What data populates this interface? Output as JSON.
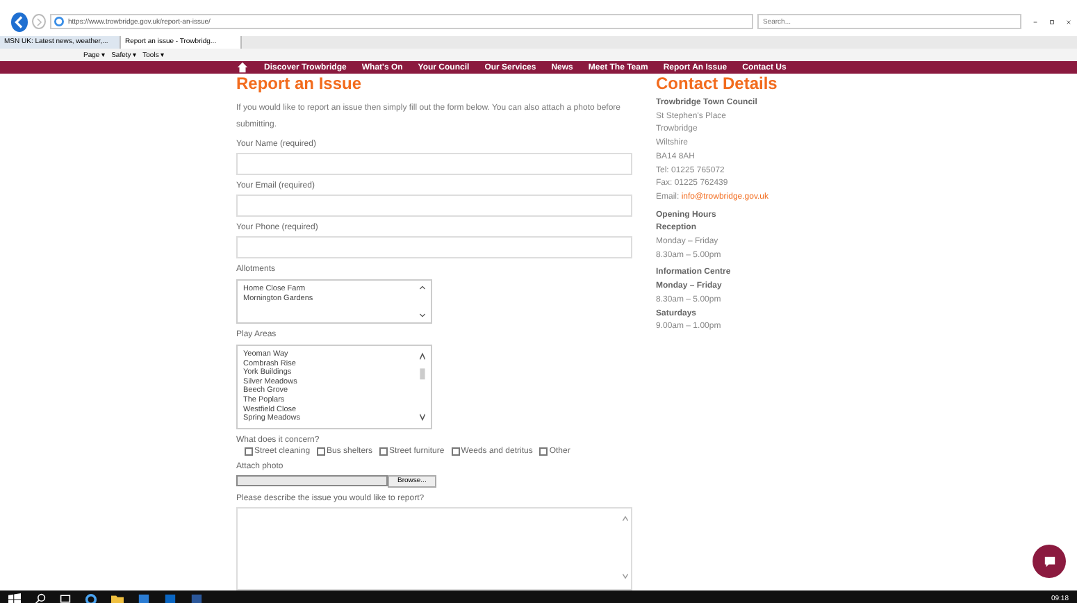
{
  "browser": {
    "address": "https://www.trowbridge.gov.uk/report-an-issue/",
    "search": {
      "placeholder": "Search..."
    },
    "tabs": [
      {
        "title": "MSN UK: Latest news, weather,...",
        "selected": false
      },
      {
        "title": "Report an issue - Trowbridg...",
        "selected": true
      }
    ],
    "commands": [
      "Page ▾",
      "Safety ▾",
      "Tools ▾"
    ]
  },
  "nav": {
    "items": [
      "Discover Trowbridge",
      "What's On",
      "Your Council",
      "Our Services",
      "News",
      "Meet The Team",
      "Report An Issue",
      "Contact Us"
    ]
  },
  "form": {
    "title": "Report an Issue",
    "intro": "If you would like to report an issue then simply fill out the form below. You can also attach a photo before submitting.",
    "fields": [
      {
        "kind": "text",
        "label": "Your Name (required)"
      },
      {
        "kind": "text",
        "label": "Your Email (required)"
      },
      {
        "kind": "text",
        "label": "Your Phone (required)"
      },
      {
        "kind": "listbox",
        "label": "Allotments",
        "options": [
          "Home Close Farm",
          "Mornington Gardens"
        ]
      },
      {
        "kind": "listbox",
        "label": "Play Areas",
        "options": [
          "Yeoman Way",
          "Combrash Rise",
          "York Buildings",
          "Silver Meadows",
          "Beech Grove",
          "The Poplars",
          "Westfield Close",
          "Spring Meadows"
        ]
      },
      {
        "kind": "checkboxes",
        "label": "What does it concern?",
        "options": [
          {
            "label": "Street cleaning",
            "checked": false
          },
          {
            "label": "Bus shelters",
            "checked": false
          },
          {
            "label": "Street furniture",
            "checked": false
          },
          {
            "label": "Weeds and detritus",
            "checked": false
          },
          {
            "label": "Other",
            "checked": false
          }
        ]
      },
      {
        "kind": "file",
        "label": "Attach photo",
        "button": "Browse..."
      },
      {
        "kind": "textarea",
        "label": "Please describe the issue you would like to report?"
      }
    ]
  },
  "contact": {
    "title": "Contact Details",
    "blocks": [
      [
        {
          "kind": "bold",
          "text": "Trowbridge Town Council"
        },
        {
          "kind": "plain",
          "text": "St Stephen's Place"
        },
        {
          "kind": "plain",
          "text": "Trowbridge"
        },
        {
          "kind": "plain",
          "text": "Wiltshire"
        },
        {
          "kind": "plain",
          "text": "BA14 8AH"
        },
        {
          "kind": "plain",
          "text": "Tel: 01225 765072"
        },
        {
          "kind": "plain",
          "text": "Fax: 01225 762439"
        },
        {
          "kind": "email",
          "label": "Email:",
          "text": "info@trowbridge.gov.uk"
        }
      ],
      [
        {
          "kind": "bold",
          "text": "Opening Hours"
        },
        {
          "kind": "bold",
          "text": "Reception"
        },
        {
          "kind": "plain",
          "text": "Monday – Friday"
        },
        {
          "kind": "plain",
          "text": "8.30am – 5.00pm"
        }
      ],
      [
        {
          "kind": "bold",
          "text": "Information Centre"
        },
        {
          "kind": "bold",
          "text": "Monday – Friday"
        },
        {
          "kind": "plain",
          "text": "8.30am – 5.00pm"
        },
        {
          "kind": "bold",
          "text": "Saturdays"
        },
        {
          "kind": "plain",
          "text": "9.00am – 1.00pm"
        }
      ]
    ]
  },
  "taskbar": {
    "time": "09:18"
  }
}
